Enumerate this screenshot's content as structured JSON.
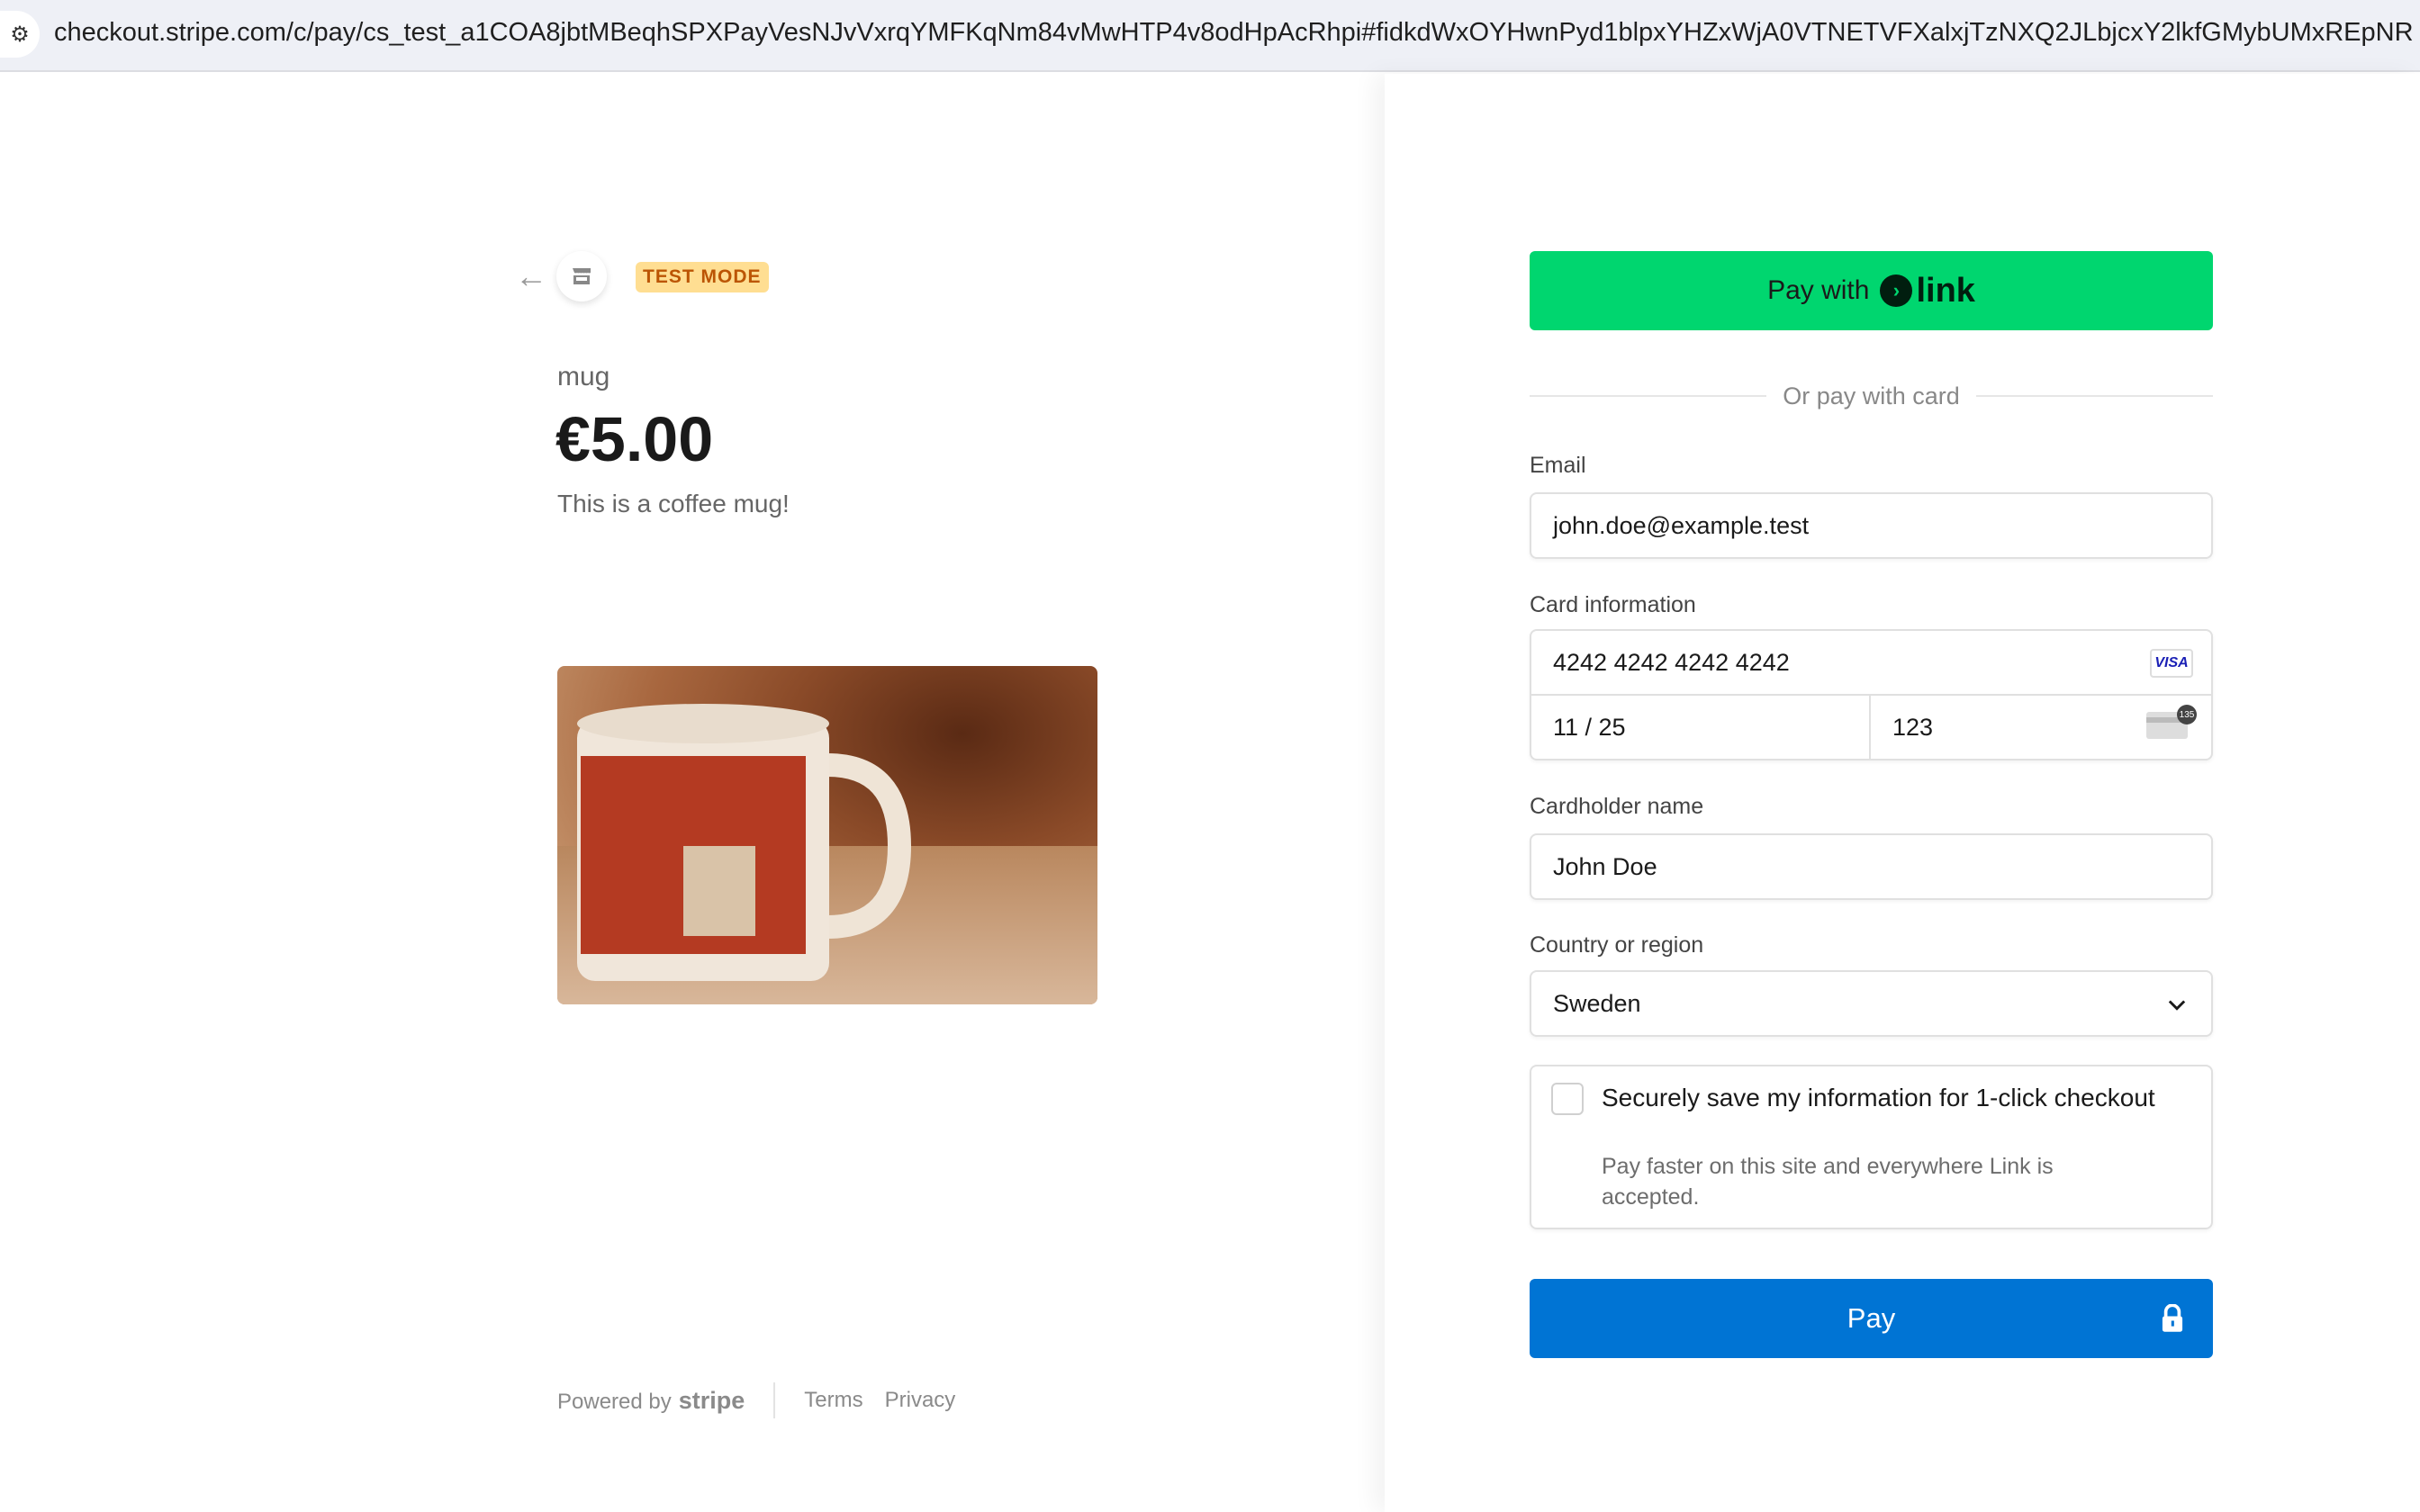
{
  "browser": {
    "url": "checkout.stripe.com/c/pay/cs_test_a1COA8jbtMBeqhSPXPayVesNJvVxrqYMFKqNm84vMwHTP4v8odHpAcRhpi#fidkdWxOYHwnPyd1blpxYHZxWjA0VTNETVFXalxjTzNXQ2JLbjcxY2lkfGMybUMxREpNR",
    "site_icon": "tune-icon"
  },
  "header": {
    "badge": "TEST MODE"
  },
  "product": {
    "name": "mug",
    "price": "€5.00",
    "description": "This is a coffee mug!"
  },
  "footer": {
    "powered_by": "Powered by",
    "brand": "stripe",
    "terms": "Terms",
    "privacy": "Privacy"
  },
  "form": {
    "link_button": {
      "prefix": "Pay with",
      "brand": "link"
    },
    "divider": "Or pay with card",
    "email": {
      "label": "Email",
      "value": "john.doe@example.test"
    },
    "card": {
      "label": "Card information",
      "number": "4242 4242 4242 4242",
      "brand": "VISA",
      "expiry": "11 / 25",
      "cvc": "123",
      "cvc_hint": "135"
    },
    "cardholder": {
      "label": "Cardholder name",
      "value": "John Doe"
    },
    "country": {
      "label": "Country or region",
      "value": "Sweden"
    },
    "save": {
      "title": "Securely save my information for 1-click checkout",
      "subtitle": "Pay faster on this site and everywhere Link is accepted.",
      "checked": false
    },
    "pay_button": "Pay"
  },
  "colors": {
    "link_green": "#00d66f",
    "pay_blue": "#0074d4",
    "badge_bg": "#ffde92",
    "badge_text": "#bb5504"
  }
}
